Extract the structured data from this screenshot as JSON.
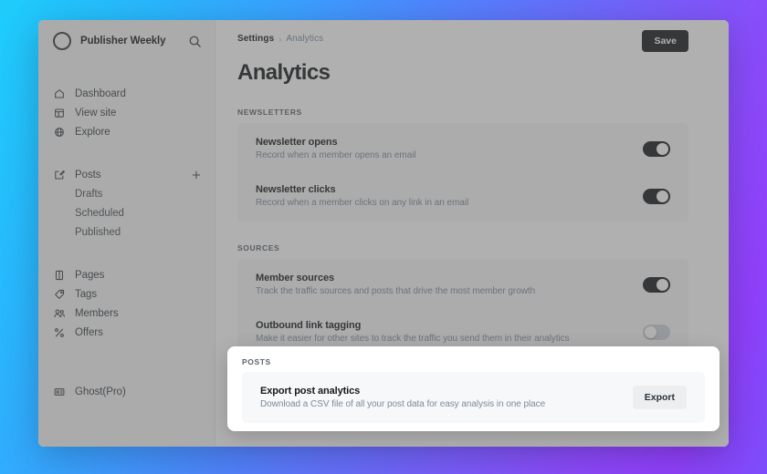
{
  "theme": {
    "bg_gradient_from": "#1ecdfc",
    "bg_gradient_mid": "#6470fb",
    "bg_gradient_to": "#8b4afa",
    "accent_dark": "#15171a",
    "card_bg": "#f7f8f9",
    "sidebar_bg": "#f5f5f5",
    "muted_text": "#7c8b9a"
  },
  "sidebar": {
    "brand": {
      "name": "Publisher Weekly",
      "avatar_icon": "circle-avatar-icon",
      "search_icon": "search-icon"
    },
    "primary_items": [
      {
        "label": "Dashboard",
        "icon": "home-icon"
      },
      {
        "label": "View site",
        "icon": "layout-icon"
      },
      {
        "label": "Explore",
        "icon": "globe-icon"
      }
    ],
    "posts_group": {
      "label": "Posts",
      "icon": "edit-square-icon",
      "add_icon": "plus-icon",
      "children": [
        {
          "label": "Drafts"
        },
        {
          "label": "Scheduled"
        },
        {
          "label": "Published"
        }
      ]
    },
    "secondary_items": [
      {
        "label": "Pages",
        "icon": "pages-icon"
      },
      {
        "label": "Tags",
        "icon": "tag-icon"
      },
      {
        "label": "Members",
        "icon": "members-icon"
      },
      {
        "label": "Offers",
        "icon": "percent-icon"
      }
    ],
    "footer_items": [
      {
        "label": "Ghost(Pro)",
        "icon": "billing-card-icon"
      }
    ]
  },
  "header": {
    "breadcrumb_root": "Settings",
    "breadcrumb_separator": "›",
    "breadcrumb_leaf": "Analytics",
    "page_title": "Analytics",
    "save_label": "Save"
  },
  "sections": {
    "newsletters": {
      "label": "Newsletters",
      "rows": [
        {
          "title": "Newsletter opens",
          "desc": "Record when a member opens an email",
          "toggle_state": "on"
        },
        {
          "title": "Newsletter clicks",
          "desc": "Record when a member clicks on any link in an email",
          "toggle_state": "on"
        }
      ]
    },
    "sources": {
      "label": "Sources",
      "rows": [
        {
          "title": "Member sources",
          "desc": "Track the traffic sources and posts that drive the most member growth",
          "toggle_state": "on"
        },
        {
          "title": "Outbound link tagging",
          "desc": "Make it easier for other sites to track the traffic you send them in their analytics",
          "toggle_state": "off"
        }
      ]
    },
    "posts": {
      "label": "Posts",
      "row": {
        "title": "Export post analytics",
        "desc": "Download a CSV file of all your post data for easy analysis in one place",
        "button_label": "Export"
      }
    }
  }
}
